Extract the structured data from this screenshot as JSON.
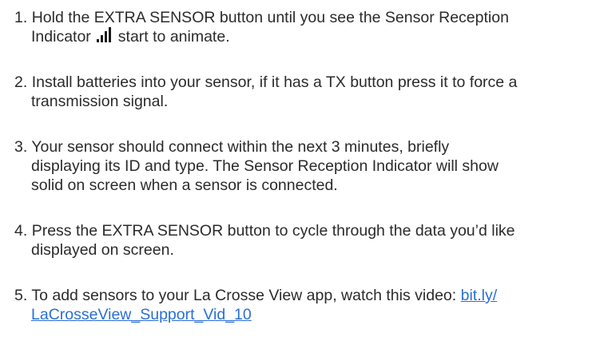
{
  "steps": [
    {
      "number": "1.",
      "line1": "Hold the EXTRA SENSOR button until you see the Sensor Reception",
      "line2_before_icon": "Indicator",
      "icon": "signal-bars-icon",
      "line2_after_icon": "start to animate."
    },
    {
      "number": "2.",
      "line1": "Install batteries into your sensor, if it has a TX button press it to force a",
      "line2": "transmission signal."
    },
    {
      "number": "3.",
      "line1": "Your sensor should connect within the next 3 minutes, briefly",
      "line2": "displaying its ID and type. The Sensor Reception Indicator will show",
      "line3": "solid on screen when a sensor is connected."
    },
    {
      "number": "4.",
      "line1": "Press the EXTRA SENSOR button to cycle through the data you’d like",
      "line2": "displayed on screen."
    },
    {
      "number": "5.",
      "line1_text": "To add sensors to your La Crosse View app, watch this video:",
      "link_part1": "bit.ly/",
      "link_part2": "LaCrosseView_Support_Vid_10"
    }
  ],
  "colors": {
    "text": "#2b2b2b",
    "link": "#2a6fd6",
    "icon": "#1a1a1a"
  }
}
